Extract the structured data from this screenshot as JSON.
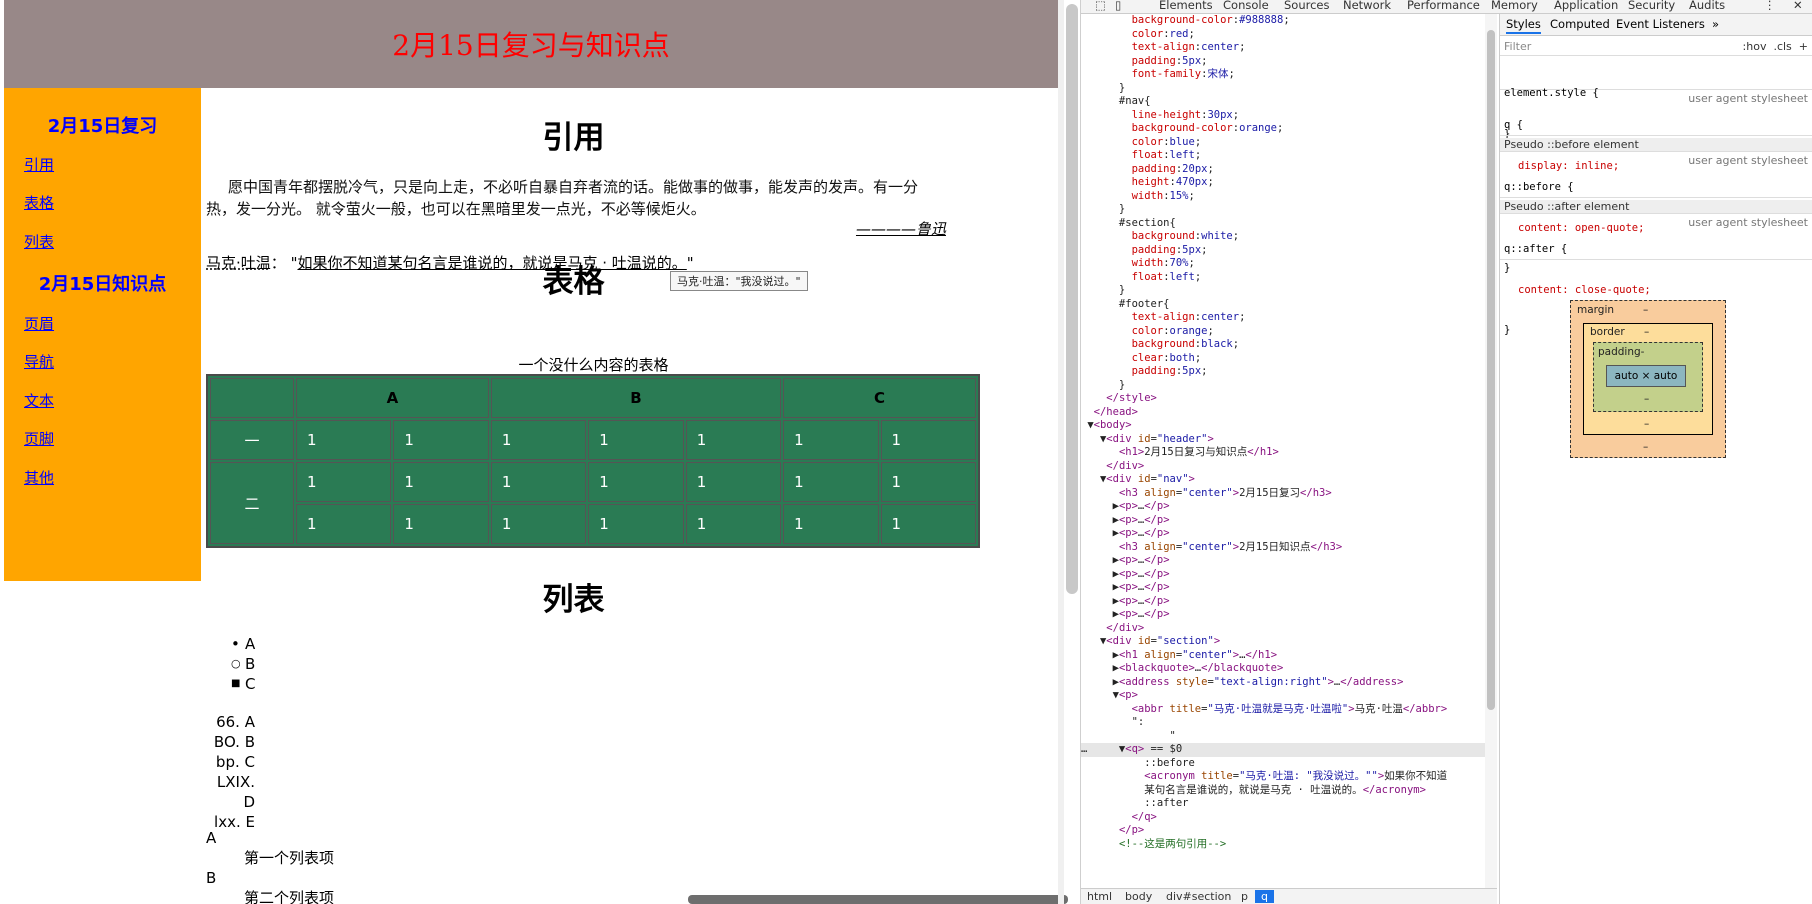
{
  "page": {
    "header_title": "2月15日复习与知识点",
    "nav": {
      "heading1": "2月15日复习",
      "group1": [
        "引用",
        "表格",
        "列表"
      ],
      "heading2": "2月15日知识点",
      "group2": [
        "页眉",
        "导航",
        "文本",
        "页脚",
        "其他"
      ]
    },
    "section": {
      "h_quote": "引用",
      "quote_text": "愿中国青年都摆脱冷气，只是向上走，不必听自暴自弃者流的话。能做事的做事，能发声的发声。有一分热，发一分光。 就令萤火一般，也可以在黑暗里发一点光，不必等候炬火。",
      "address": "————鲁迅",
      "abbr": "马克·吐温",
      "abbr_sep": "：",
      "q_text": "如果你不知道某句名言是谁说的，就说是马克 · 吐温说的。",
      "tooltip": "马克·吐温：\"我没说过。\"",
      "h_table": "表格",
      "table_caption": "一个没什么内容的表格",
      "table_headers": [
        "",
        "A",
        "B",
        "C"
      ],
      "row_labels": [
        "一",
        "二"
      ],
      "cell_value": "1",
      "h_list": "列表",
      "ul": [
        "A",
        "B",
        "C"
      ],
      "ol_markers": [
        "66.",
        "BO.",
        "bp.",
        "LXIX.",
        "lxx."
      ],
      "ol_items": [
        "A",
        "B",
        "C",
        "D",
        "E"
      ],
      "dl": [
        {
          "dt": "A",
          "dd": "第一个列表项"
        },
        {
          "dt": "B",
          "dd": "第二个列表项"
        }
      ]
    }
  },
  "devtools": {
    "tabs": [
      "Elements",
      "Console",
      "Sources",
      "Network",
      "Performance",
      "Memory",
      "Application",
      "Security",
      "Audits"
    ],
    "styles_tabs": [
      "Styles",
      "Computed",
      "Event Listeners",
      "»"
    ],
    "filter_placeholder": "Filter",
    "filter_tools": ":hov  .cls  +",
    "breadcrumbs": [
      "html",
      "body",
      "div#section",
      "p",
      "q"
    ],
    "element_style": "element.style {",
    "rule_q": "q {",
    "rule_q_prop": "display: inline;",
    "ua_label": "user agent stylesheet",
    "pseudo_before": "Pseudo ::before element",
    "before_rule": "q::before {",
    "before_prop": "content: open-quote;",
    "pseudo_after": "Pseudo ::after element",
    "after_rule": "q::after {",
    "after_prop": "content: close-quote;",
    "box": {
      "margin": "margin",
      "border": "border",
      "padding": "padding-",
      "content": "auto × auto",
      "dash": "–"
    }
  },
  "colors": {
    "header_bg": "#988888",
    "nav_bg": "#ffa500",
    "table_bg": "#2a7b54",
    "link": "#0000ff"
  }
}
